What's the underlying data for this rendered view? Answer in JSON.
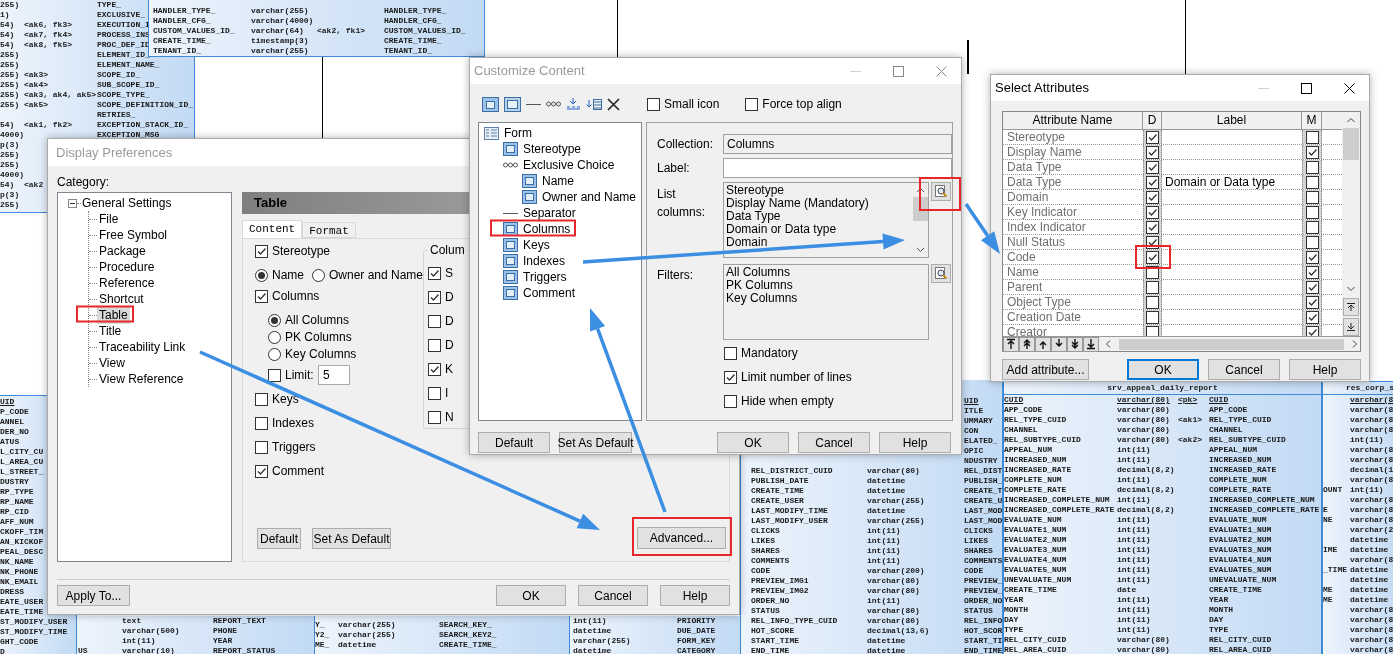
{
  "diagram": {
    "tables": [
      {
        "underline_first": false,
        "rows": [
          {
            "column_1": "255)",
            "column_3": "TYPE_"
          },
          {
            "column_1": "1)",
            "column_3": "EXCLUSIVE_"
          },
          {
            "column_1": "54)",
            "column_2": "<ak6, fk3>",
            "column_3": "EXECUTION_I"
          },
          {
            "column_1": "54)",
            "column_2": "<ak7, fk4>",
            "column_3": "PROCESS_INS"
          },
          {
            "column_1": "54)",
            "column_2": "<ak8, fk5>",
            "column_3": "PROC_DEF_ID"
          },
          {
            "column_1": "255)",
            "column_3": "ELEMENT_ID_"
          },
          {
            "column_1": "255)",
            "column_3": "ELEMENT_NAME_"
          },
          {
            "column_1": "255)",
            "column_2": "<ak3>",
            "column_3": "SCOPE_ID_"
          },
          {
            "column_1": "255)",
            "column_2": "<ak4>",
            "column_3": "SUB_SCOPE_ID_"
          },
          {
            "column_1": "255)",
            "column_2": "<ak3, ak4, ak5>",
            "column_3": "SCOPE_TYPE_"
          },
          {
            "column_1": "255)",
            "column_2": "<ak5>",
            "column_3": "SCOPE_DEFINITION_ID_"
          },
          {
            "column_3": "RETRIES_"
          },
          {
            "column_1": "54)",
            "column_2": "<ak1, fk2>",
            "column_3": "EXCEPTION_STACK_ID_"
          },
          {
            "column_1": "4000)",
            "column_3": "EXCEPTION_MSG"
          },
          {
            "column_1": "p(3)"
          },
          {
            "column_1": "255)"
          },
          {
            "column_1": "255)"
          },
          {
            "column_1": "4000)"
          },
          {
            "column_1": "54)",
            "column_2": "<ak2"
          },
          {
            "column_1": "p(3)"
          },
          {
            "column_1": "255)"
          }
        ]
      },
      {
        "underline_first": false,
        "rows": [
          {
            "column_1": "HANDLER_TYPE_",
            "column_2": "varchar(255)",
            "column_4": "HANDLER_TYPE_"
          },
          {
            "column_1": "HANDLER_CFG_",
            "column_2": "varchar(4000)",
            "column_4": "HANDLER_CFG_"
          },
          {
            "column_1": "CUSTOM_VALUES_ID_",
            "column_2": "varchar(64)",
            "column_3": "<ak2, fk1>",
            "column_4": "CUSTOM_VALUES_ID_"
          },
          {
            "column_1": "CREATE_TIME_",
            "column_2": "timestamp(3)",
            "column_4": "CREATE_TIME_"
          },
          {
            "column_1": "TENANT_ID_",
            "column_2": "varchar(255)",
            "column_4": "TENANT_ID_"
          }
        ]
      },
      {
        "underline_first": true,
        "rows": [
          {
            "column_1": "UID"
          },
          {
            "column_1": "P_CODE"
          },
          {
            "column_1": "ANNEL"
          },
          {
            "column_1": "DER_NO"
          },
          {
            "column_1": "ATUS"
          },
          {
            "column_1": "L_CITY_CU"
          },
          {
            "column_1": "L_AREA_CU"
          },
          {
            "column_1": "L_STREET_"
          },
          {
            "column_1": "DUSTRY"
          },
          {
            "column_1": "RP_TYPE"
          },
          {
            "column_1": "RP_NAME"
          },
          {
            "column_1": "RP_CID"
          },
          {
            "column_1": "AFF_NUM"
          },
          {
            "column_1": "CKOFF_TIM"
          },
          {
            "column_1": "AN_KICKOF"
          },
          {
            "column_1": "PEAL_DESC"
          },
          {
            "column_1": "NK_NAME"
          },
          {
            "column_1": "NK_PHONE"
          },
          {
            "column_1": "NK_EMAIL"
          },
          {
            "column_1": "DRESS"
          },
          {
            "column_1": "EATE_USER"
          },
          {
            "column_1": "EATE_TIME"
          },
          {
            "column_1": "ST_MODIFY_USER"
          },
          {
            "column_1": "ST_MODIFY_TIME"
          },
          {
            "column_1": "GHT_CODE"
          },
          {
            "column_1": "D"
          }
        ]
      },
      {
        "underline_first": false,
        "rows": [
          {
            "column_2": "text",
            "column_3": "REPORT_TEXT"
          },
          {
            "column_2": "varchar(500)",
            "column_3": "PHONE"
          },
          {
            "column_2": "int(11)",
            "column_3": "YEAR"
          },
          {
            "column_1": "US",
            "column_2": "varchar(10)",
            "column_3": "REPORT_STATUS"
          }
        ]
      },
      {
        "underline_first": false,
        "rows": [
          {
            "column_1": "Y_",
            "column_2": "varchar(255)",
            "column_3": "SEARCH_KEY_"
          },
          {
            "column_1": "Y2_",
            "column_2": "varchar(255)",
            "column_3": "SEARCH_KEY2_"
          },
          {
            "column_1": "ME_",
            "column_2": "datetime",
            "column_3": "CREATE_TIME_"
          }
        ]
      },
      {
        "underline_first": false,
        "rows": [
          {
            "column_2": "int(11)",
            "column_3": "PRIORITY"
          },
          {
            "column_2": "datetime",
            "column_3": "DUE_DATE"
          },
          {
            "column_2": "varchar(255)",
            "column_3": "FORM_KEY"
          },
          {
            "column_2": "datetime",
            "column_3": "CATEGORY"
          }
        ]
      },
      {
        "underline_first": true,
        "rows": [
          {
            "column_4": "UID"
          },
          {
            "column_4": "ITLE"
          },
          {
            "column_4": "UMMARY"
          },
          {
            "column_4": "CON"
          },
          {
            "column_4": "ELATED_"
          },
          {
            "column_4": "OPIC"
          },
          {
            "column_4": "NDUSTRY"
          },
          {
            "column_2": "REL_DISTRICT_CUID",
            "column_3": "varchar(80)",
            "column_4": "REL_DIST"
          },
          {
            "column_2": "PUBLISH_DATE",
            "column_3": "datetime",
            "column_4": "PUBLISH_"
          },
          {
            "column_2": "CREATE_TIME",
            "column_3": "datetime",
            "column_4": "CREATE_T"
          },
          {
            "column_2": "CREATE_USER",
            "column_3": "varchar(255)",
            "column_4": "CREATE_U"
          },
          {
            "column_2": "LAST_MODIFY_TIME",
            "column_3": "datetime",
            "column_4": "LAST_MOD"
          },
          {
            "column_2": "LAST_MODIFY_USER",
            "column_3": "varchar(255)",
            "column_4": "LAST_MOD"
          },
          {
            "column_2": "CLICKS",
            "column_3": "int(11)",
            "column_4": "CLICKS"
          },
          {
            "column_2": "LIKES",
            "column_3": "int(11)",
            "column_4": "LIKES"
          },
          {
            "column_2": "SHARES",
            "column_3": "int(11)",
            "column_4": "SHARES"
          },
          {
            "column_2": "COMMENTS",
            "column_3": "int(11)",
            "column_4": "COMMENTS"
          },
          {
            "column_2": "CODE",
            "column_3": "varchar(200)",
            "column_4": "CODE"
          },
          {
            "column_2": "PREVIEW_IMG1",
            "column_3": "varchar(80)",
            "column_4": "PREVIEW_"
          },
          {
            "column_2": "PREVIEW_IMG2",
            "column_3": "varchar(80)",
            "column_4": "PREVIEW_"
          },
          {
            "column_2": "ORDER_NO",
            "column_3": "int(11)",
            "column_4": "ORDER_NO"
          },
          {
            "column_2": "STATUS",
            "column_3": "varchar(80)",
            "column_4": "STATUS"
          },
          {
            "column_2": "REL_INFO_TYPE_CUID",
            "column_3": "varchar(80)",
            "column_4": "REL_INFO"
          },
          {
            "column_2": "HOT_SCORE",
            "column_3": "decimal(13,6)",
            "column_4": "HOT_SCOR"
          },
          {
            "column_2": "START_TIME",
            "column_3": "datetime",
            "column_4": "START_TI"
          },
          {
            "column_2": "END_TIME",
            "column_3": "datetime",
            "column_4": "END_TIME"
          }
        ]
      },
      {
        "title": "srv_appeal_daily_report",
        "underline_first": true,
        "rows": [
          {
            "column_1": "CUID",
            "column_2": "varchar(80)",
            "column_3": "<pk>",
            "column_4": "CUID"
          },
          {
            "column_1": "APP_CODE",
            "column_2": "varchar(80)",
            "column_4": "APP_CODE"
          },
          {
            "column_1": "REL_TYPE_CUID",
            "column_2": "varchar(80)",
            "column_3": "<ak1>",
            "column_4": "REL_TYPE_CUID"
          },
          {
            "column_1": "CHANNEL",
            "column_2": "varchar(80)",
            "column_4": "CHANNEL"
          },
          {
            "column_1": "REL_SUBTYPE_CUID",
            "column_2": "varchar(80)",
            "column_3": "<ak2>",
            "column_4": "REL_SUBTYPE_CUID"
          },
          {
            "column_1": "APPEAL_NUM",
            "column_2": "int(11)",
            "column_4": "APPEAL_NUM"
          },
          {
            "column_1": "INCREASED_NUM",
            "column_2": "int(11)",
            "column_4": "INCREASED_NUM"
          },
          {
            "column_1": "INCREASED_RATE",
            "column_2": "decimal(8,2)",
            "column_4": "INCREASED_RATE"
          },
          {
            "column_1": "COMPLETE_NUM",
            "column_2": "int(11)",
            "column_4": "COMPLETE_NUM"
          },
          {
            "column_1": "COMPLETE_RATE",
            "column_2": "decimal(8,2)",
            "column_4": "COMPLETE_RATE"
          },
          {
            "column_1": "INCREASED_COMPLETE_NUM",
            "column_2": "int(11)",
            "column_4": "INCREASED_COMPLETE_NUM"
          },
          {
            "column_1": "INCREASED_COMPLETE_RATE",
            "column_2": "decimal(8,2)",
            "column_4": "INCREASED_COMPLETE_RATE"
          },
          {
            "column_1": "EVALUATE_NUM",
            "column_2": "int(11)",
            "column_4": "EVALUATE_NUM"
          },
          {
            "column_1": "EVALUATE1_NUM",
            "column_2": "int(11)",
            "column_4": "EVALUATE1_NUM"
          },
          {
            "column_1": "EVALUATE2_NUM",
            "column_2": "int(11)",
            "column_4": "EVALUATE2_NUM"
          },
          {
            "column_1": "EVALUATE3_NUM",
            "column_2": "int(11)",
            "column_4": "EVALUATE3_NUM"
          },
          {
            "column_1": "EVALUATE4_NUM",
            "column_2": "int(11)",
            "column_4": "EVALUATE4_NUM"
          },
          {
            "column_1": "EVALUATE5_NUM",
            "column_2": "int(11)",
            "column_4": "EVALUATE5_NUM"
          },
          {
            "column_1": "UNEVALUATE_NUM",
            "column_2": "int(11)",
            "column_4": "UNEVALUATE_NUM"
          },
          {
            "column_1": "CREATE_TIME",
            "column_2": "date",
            "column_4": "CREATE_TIME"
          },
          {
            "column_1": "YEAR",
            "column_2": "int(11)",
            "column_4": "YEAR"
          },
          {
            "column_1": "MONTH",
            "column_2": "int(11)",
            "column_4": "MONTH"
          },
          {
            "column_1": "DAY",
            "column_2": "int(11)",
            "column_4": "DAY"
          },
          {
            "column_1": "TYPE",
            "column_2": "int(11)",
            "column_4": "TYPE"
          },
          {
            "column_1": "REL_CITY_CUID",
            "column_2": "varchar(80)",
            "column_4": "REL_CITY_CUID"
          },
          {
            "column_1": "REL_AREA_CUID",
            "column_2": "varchar(80)",
            "column_4": "REL_AREA_CUID"
          }
        ]
      },
      {
        "title": "res_corp_s",
        "underline_first": true,
        "rows": [
          {
            "column_2": "varchar(8"
          },
          {
            "column_2": "varchar(8"
          },
          {
            "column_2": "varchar(8"
          },
          {
            "column_2": "varchar(8"
          },
          {
            "column_2": "int(11)"
          },
          {
            "column_2": "varchar(8"
          },
          {
            "column_2": "varchar(8"
          },
          {
            "column_2": "decimal(1"
          },
          {
            "column_2": "varchar(8"
          },
          {
            "column_1": "OUNT",
            "column_2": "int(11)"
          },
          {
            "column_2": "varchar(8"
          },
          {
            "column_1": "E",
            "column_2": "varchar(8"
          },
          {
            "column_1": "NE",
            "column_2": "varchar(8"
          },
          {
            "column_2": "varchar(2"
          },
          {
            "column_2": "datetime"
          },
          {
            "column_1": "IME",
            "column_2": "datetime"
          },
          {
            "column_2": "varchar(8"
          },
          {
            "column_1": "_TIME",
            "column_2": "datetime"
          },
          {
            "column_2": "datetime"
          },
          {
            "column_1": "ME",
            "column_2": "datetime"
          },
          {
            "column_1": "ME",
            "column_2": "datetime"
          },
          {
            "column_2": "varchar(8"
          },
          {
            "column_2": "varchar(8"
          },
          {
            "column_2": "varchar(8"
          },
          {
            "column_2": "varchar(8"
          },
          {
            "column_2": "varchar(8"
          }
        ]
      }
    ]
  },
  "display_preferences": {
    "title": "Display Preferences",
    "active": false,
    "category_label": "Category:",
    "tree": {
      "label": "General Settings",
      "expanded": true,
      "children": [
        {
          "label": "File",
          "selected": false
        },
        {
          "label": "Free Symbol",
          "selected": false
        },
        {
          "label": "Package",
          "selected": false
        },
        {
          "label": "Procedure",
          "selected": false
        },
        {
          "label": "Reference",
          "selected": false
        },
        {
          "label": "Shortcut",
          "selected": false
        },
        {
          "label": "Table",
          "selected": true
        },
        {
          "label": "Title",
          "selected": false
        },
        {
          "label": "Traceability Link",
          "selected": false
        },
        {
          "label": "View",
          "selected": false
        },
        {
          "label": "View Reference",
          "selected": false
        }
      ]
    },
    "panel_title": "Table",
    "tabs": [
      {
        "label": "Content",
        "selected": true
      },
      {
        "label": "Format",
        "selected": false
      }
    ],
    "stereotype": {
      "label": "Stereotype",
      "checked": true
    },
    "name_options": [
      {
        "label": "Name",
        "selected": true
      },
      {
        "label": "Owner and Name",
        "selected": false
      }
    ],
    "columns": {
      "label": "Columns",
      "checked": true
    },
    "column_options": [
      {
        "label": "All Columns",
        "selected": true
      },
      {
        "label": "PK Columns",
        "selected": false
      },
      {
        "label": "Key Columns",
        "selected": false
      }
    ],
    "limit": {
      "label": "Limit:",
      "checked": false,
      "value": "5"
    },
    "other_options": [
      {
        "label": "Keys",
        "checked": false
      },
      {
        "label": "Indexes",
        "checked": false
      },
      {
        "label": "Triggers",
        "checked": false
      },
      {
        "label": "Comment",
        "checked": true
      }
    ],
    "column_group": {
      "title": "Colum",
      "items": [
        {
          "label": "S",
          "checked": true
        },
        {
          "label": "D",
          "checked": true
        },
        {
          "label": "D",
          "checked": false
        },
        {
          "label": "D",
          "checked": false
        },
        {
          "label": "K",
          "checked": true
        },
        {
          "label": "I",
          "checked": false
        },
        {
          "label": "N",
          "checked": false
        }
      ]
    },
    "panel_buttons": [
      "Default",
      "Set As Default"
    ],
    "advanced_button": "Advanced...",
    "apply_button": "Apply To...",
    "buttons": [
      "OK",
      "Cancel",
      "Help"
    ]
  },
  "customize_content": {
    "title": "Customize Content",
    "active": false,
    "toolbar_checks": [
      {
        "label": "Small icon",
        "checked": false
      },
      {
        "label": "Force top align",
        "checked": false
      }
    ],
    "tree": [
      {
        "label": "Form",
        "kind": "form",
        "children": [
          {
            "label": "Stereotype",
            "kind": "attribute"
          },
          {
            "label": "Exclusive Choice",
            "kind": "choice",
            "children": [
              {
                "label": "Name",
                "kind": "attribute"
              },
              {
                "label": "Owner and Name",
                "kind": "attribute"
              }
            ]
          },
          {
            "label": "Separator",
            "kind": "separator"
          },
          {
            "label": "Columns",
            "kind": "attribute"
          },
          {
            "label": "Keys",
            "kind": "attribute"
          },
          {
            "label": "Indexes",
            "kind": "attribute"
          },
          {
            "label": "Triggers",
            "kind": "attribute"
          },
          {
            "label": "Comment",
            "kind": "attribute"
          }
        ]
      }
    ],
    "collection": {
      "label": "Collection:",
      "value": "Columns"
    },
    "label_field": {
      "label": "Label:"
    },
    "list_columns": {
      "label": "List columns:",
      "items": [
        "Stereotype",
        "Display Name (Mandatory)",
        "Data Type",
        "Domain or Data type",
        "Domain"
      ]
    },
    "filters": {
      "label": "Filters:",
      "items": [
        "All Columns",
        "PK Columns",
        "Key Columns"
      ]
    },
    "options": [
      {
        "label": "Mandatory",
        "checked": false
      },
      {
        "label": "Limit number of lines",
        "checked": true
      },
      {
        "label": "Hide when empty",
        "checked": false
      }
    ],
    "left_buttons": [
      "Default",
      "Set As Default"
    ],
    "buttons": [
      "OK",
      "Cancel",
      "Help"
    ]
  },
  "select_attributes": {
    "title": "Select Attributes",
    "active": true,
    "columns": [
      "Attribute Name",
      "D",
      "Label",
      "M"
    ],
    "rows": [
      {
        "name": "Stereotype",
        "d": true,
        "m": false
      },
      {
        "name": "Display Name",
        "d": true,
        "m": true
      },
      {
        "name": "Data Type",
        "d": true,
        "m": false
      },
      {
        "name": "Data Type",
        "d": true,
        "label": "Domain or Data type",
        "m": false
      },
      {
        "name": "Domain",
        "d": true,
        "m": false
      },
      {
        "name": "Key Indicator",
        "d": true,
        "m": false
      },
      {
        "name": "Index Indicator",
        "d": true,
        "m": false
      },
      {
        "name": "Null Status",
        "d": true,
        "m": false
      },
      {
        "name": "Code",
        "d": true,
        "m": true
      },
      {
        "name": "Name",
        "d": false,
        "m": true
      },
      {
        "name": "Parent",
        "d": false,
        "m": true
      },
      {
        "name": "Object Type",
        "d": false,
        "m": true
      },
      {
        "name": "Creation Date",
        "d": false,
        "m": true
      },
      {
        "name": "Creator",
        "d": false,
        "m": true
      }
    ],
    "add_button": "Add attribute...",
    "buttons": [
      {
        "label": "OK",
        "focused": true
      },
      {
        "label": "Cancel",
        "focused": false
      },
      {
        "label": "Help",
        "focused": false
      }
    ]
  }
}
